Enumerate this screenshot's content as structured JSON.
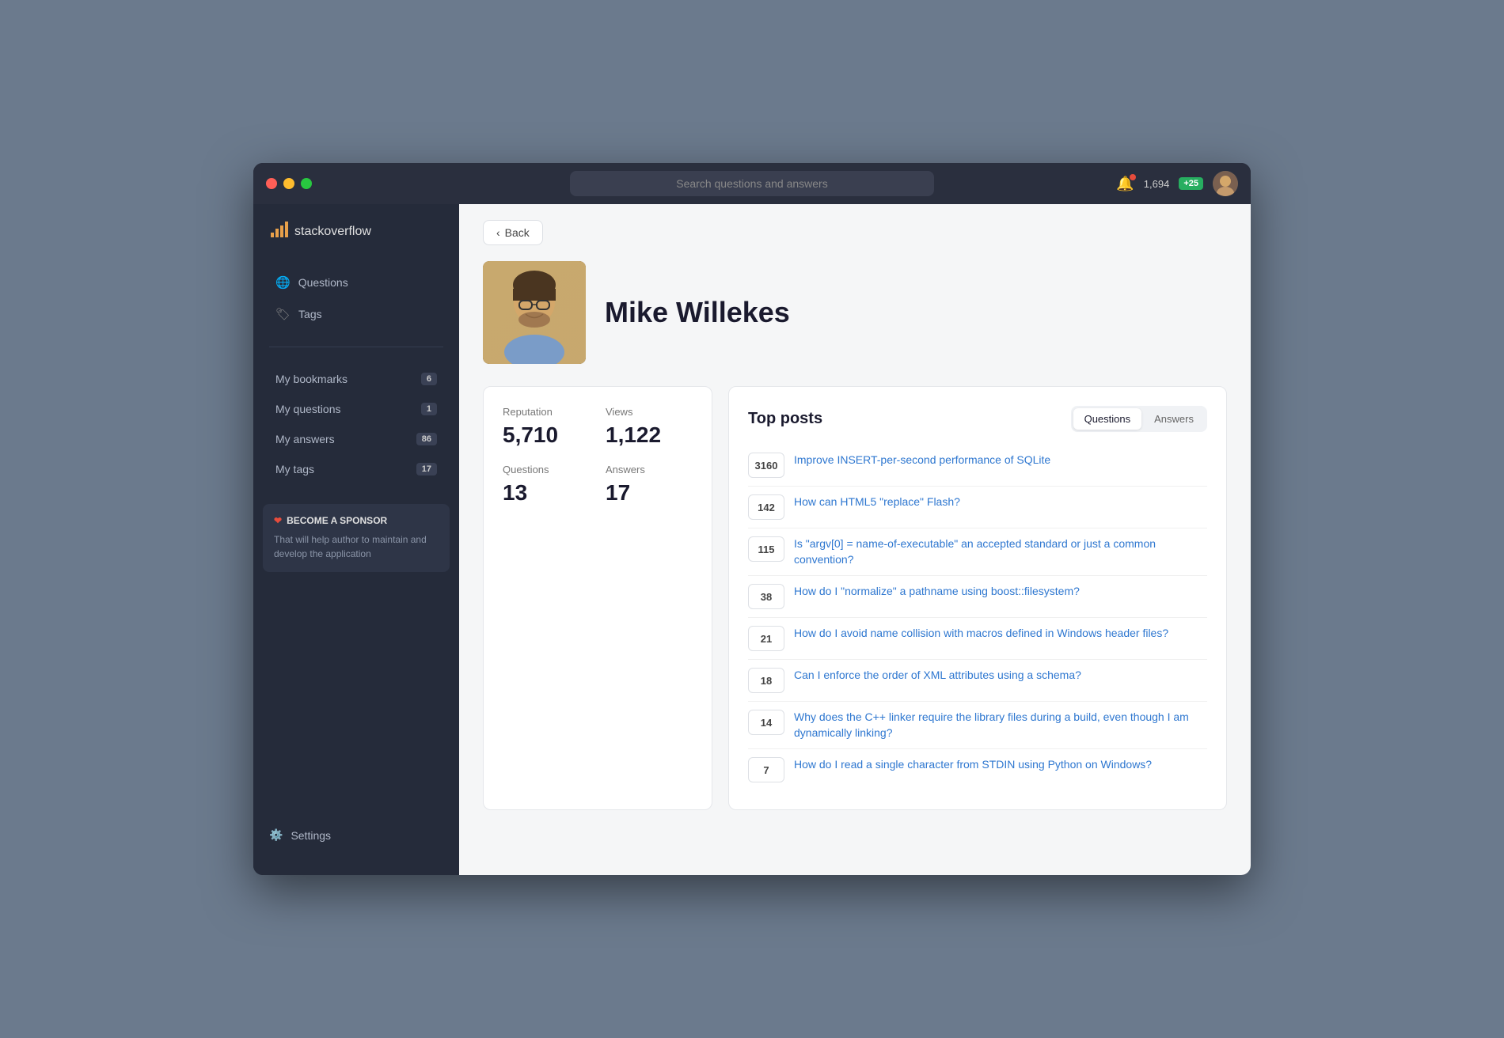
{
  "titlebar": {
    "search_placeholder": "Search questions and answers",
    "rep_count": "1,694",
    "plus_badge": "+25"
  },
  "sidebar": {
    "logo_text": "stackoverflow",
    "nav_items": [
      {
        "id": "questions",
        "label": "Questions",
        "icon": "🌐"
      },
      {
        "id": "tags",
        "label": "Tags",
        "icon": "🏷"
      }
    ],
    "links": [
      {
        "id": "bookmarks",
        "label": "My bookmarks",
        "count": "6"
      },
      {
        "id": "my-questions",
        "label": "My questions",
        "count": "1"
      },
      {
        "id": "answers",
        "label": "My answers",
        "count": "86"
      },
      {
        "id": "tags",
        "label": "My tags",
        "count": "17"
      }
    ],
    "sponsor": {
      "title": "BECOME A SPONSOR",
      "text": "That will help author to maintain and develop the application"
    },
    "settings_label": "Settings"
  },
  "profile": {
    "name": "Mike Willekes",
    "stats": {
      "reputation_label": "Reputation",
      "reputation_value": "5,710",
      "views_label": "Views",
      "views_value": "1,122",
      "questions_label": "Questions",
      "questions_value": "13",
      "answers_label": "Answers",
      "answers_value": "17"
    }
  },
  "top_posts": {
    "title": "Top posts",
    "tabs": [
      {
        "id": "questions",
        "label": "Questions",
        "active": true
      },
      {
        "id": "answers",
        "label": "Answers",
        "active": false
      }
    ],
    "posts": [
      {
        "score": "3160",
        "title": "Improve INSERT-per-second performance of SQLite"
      },
      {
        "score": "142",
        "title": "How can HTML5 \"replace\" Flash?"
      },
      {
        "score": "115",
        "title": "Is \"argv[0] = name-of-executable\" an accepted standard or just a common convention?"
      },
      {
        "score": "38",
        "title": "How do I \"normalize\" a pathname using boost::filesystem?"
      },
      {
        "score": "21",
        "title": "How do I avoid name collision with macros defined in Windows header files?"
      },
      {
        "score": "18",
        "title": "Can I enforce the order of XML attributes using a schema?"
      },
      {
        "score": "14",
        "title": "Why does the C++ linker require the library files during a build, even though I am dynamically linking?"
      },
      {
        "score": "7",
        "title": "How do I read a single character from STDIN using Python on Windows?"
      }
    ]
  },
  "back_button": "Back"
}
